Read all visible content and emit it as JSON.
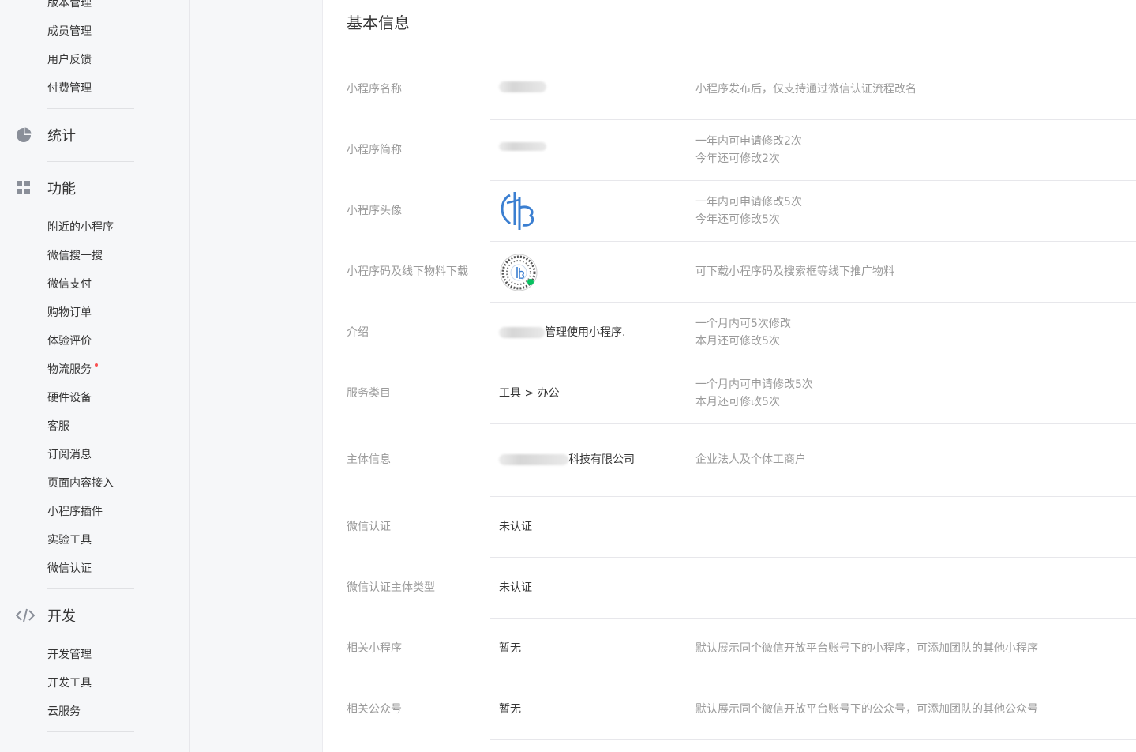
{
  "sidebar": {
    "top_items": [
      "版本管理",
      "成员管理",
      "用户反馈",
      "付费管理"
    ],
    "stats_label": "统计",
    "features_label": "功能",
    "feature_items": [
      "附近的小程序",
      "微信搜一搜",
      "微信支付",
      "购物订单",
      "体验评价",
      "物流服务",
      "硬件设备",
      "客服",
      "订阅消息",
      "页面内容接入",
      "小程序插件",
      "实验工具",
      "微信认证"
    ],
    "dev_label": "开发",
    "dev_items": [
      "开发管理",
      "开发工具",
      "云服务"
    ]
  },
  "main": {
    "title": "基本信息",
    "rows": [
      {
        "label": "小程序名称",
        "value": "",
        "tip1": "小程序发布后，仅支持通过微信认证流程改名",
        "tip2": ""
      },
      {
        "label": "小程序简称",
        "value": "",
        "tip1": "一年内可申请修改2次",
        "tip2": "今年还可修改2次"
      },
      {
        "label": "小程序头像",
        "value": "",
        "tip1": "一年内可申请修改5次",
        "tip2": "今年还可修改5次"
      },
      {
        "label": "小程序码及线下物料下载",
        "value": "",
        "tip1": "可下载小程序码及搜索框等线下推广物料",
        "tip2": ""
      },
      {
        "label": "介绍",
        "value": "管理使用小程序.",
        "tip1": "一个月内可5次修改",
        "tip2": "本月还可修改5次"
      },
      {
        "label": "服务类目",
        "value": "工具 > 办公",
        "tip1": "一个月内可申请修改5次",
        "tip2": "本月还可修改5次"
      },
      {
        "label": "主体信息",
        "value": "科技有限公司",
        "tip1": "企业法人及个体工商户",
        "tip2": ""
      },
      {
        "label": "微信认证",
        "value": "未认证",
        "tip1": "",
        "tip2": ""
      },
      {
        "label": "微信认证主体类型",
        "value": "未认证",
        "tip1": "",
        "tip2": ""
      },
      {
        "label": "相关小程序",
        "value": "暂无",
        "tip1": "默认展示同个微信开放平台账号下的小程序，可添加团队的其他小程序",
        "tip2": ""
      },
      {
        "label": "相关公众号",
        "value": "暂无",
        "tip1": "默认展示同个微信开放平台账号下的公众号，可添加团队的其他公众号",
        "tip2": ""
      }
    ]
  },
  "icons": {
    "stats": "pie-chart-icon",
    "features": "grid-icon",
    "dev": "code-icon",
    "avatar": "mini-program-avatar",
    "qrcode": "mini-program-code"
  },
  "colors": {
    "sidebar_bg": "#f6f7f9",
    "label_gray": "#9a9a9a",
    "text": "#353535",
    "divider": "#e7e7eb",
    "notify_dot": "#fa5151",
    "logo_blue": "#3b7fd1"
  }
}
